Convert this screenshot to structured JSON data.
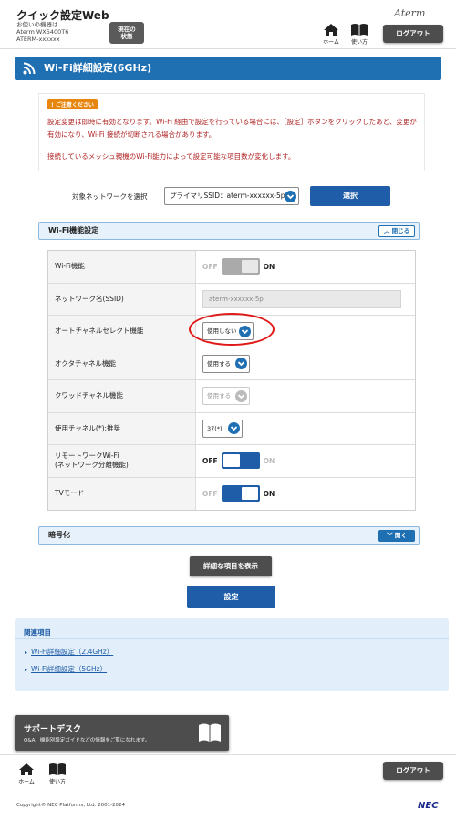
{
  "header": {
    "app_title": "クイック設定Web",
    "device_label": "お使いの機器は",
    "device_model": "Aterm WX5400T6",
    "device_id": "ATERM-xxxxxx",
    "status_button": "現在の状態",
    "logo": "Aterm",
    "home_label": "ホーム",
    "help_label": "使い方",
    "logout_label": "ログアウト"
  },
  "page_title": "Wi-Fi詳細設定(6GHz)",
  "notice": {
    "badge": "ご注意ください",
    "text1": "設定変更は即時に有効となります。Wi-Fi 経由で設定を行っている場合には、［設定］ボタンをクリックしたあと、変更が有効になり、Wi-Fi 接続が切断される場合があります。",
    "text2": "接続しているメッシュ親機のWi-Fi能力によって設定可能な項目数が変化します。"
  },
  "network_select": {
    "label": "対象ネットワークを選択",
    "value": "プライマリSSID：aterm-xxxxxx-5p",
    "button": "選択"
  },
  "wifi_section": {
    "title": "Wi-Fi機能設定",
    "toggle_label": "閉じる",
    "rows": [
      {
        "label": "Wi-Fi機能",
        "off": "OFF",
        "on": "ON",
        "state": "on-disabled"
      },
      {
        "label": "ネットワーク名(SSID)",
        "value": "aterm-xxxxxx-5p"
      },
      {
        "label": "オートチャネルセレクト機能",
        "value": "使用しない"
      },
      {
        "label": "オクタチャネル機能",
        "value": "使用する"
      },
      {
        "label": "クワッドチャネル機能",
        "value": "使用する"
      },
      {
        "label": "使用チャネル(*):推奨",
        "value": "37(*)"
      },
      {
        "label": "リモートワークWi-Fi\n(ネットワーク分離機能)",
        "off": "OFF",
        "on": "ON",
        "state": "off"
      },
      {
        "label": "TVモード",
        "off": "OFF",
        "on": "ON",
        "state": "on"
      }
    ]
  },
  "encryption_section": {
    "title": "暗号化",
    "toggle_label": "開く"
  },
  "buttons": {
    "show_details": "詳細な項目を表示",
    "apply": "設定"
  },
  "related": {
    "title": "関連項目",
    "links": [
      "Wi-Fi詳細設定（2.4GHz）",
      "Wi-Fi詳細設定（5GHz）"
    ]
  },
  "support": {
    "title": "サポートデスク",
    "subtitle": "Q&A、機能別設定ガイドなどの情報をご覧になれます。"
  },
  "footer": {
    "home_label": "ホーム",
    "help_label": "使い方",
    "logout_label": "ログアウト",
    "copyright": "Copyright© NEC Platforms, Ltd. 2001-2024",
    "nec_logo": "NEC"
  },
  "colors": {
    "primary_blue": "#1f6fb3",
    "button_blue": "#1f5da8",
    "notice_red": "#b02424",
    "badge_orange": "#e8850c",
    "dark_button": "#4d4d4d",
    "highlight_red": "#e01818"
  }
}
